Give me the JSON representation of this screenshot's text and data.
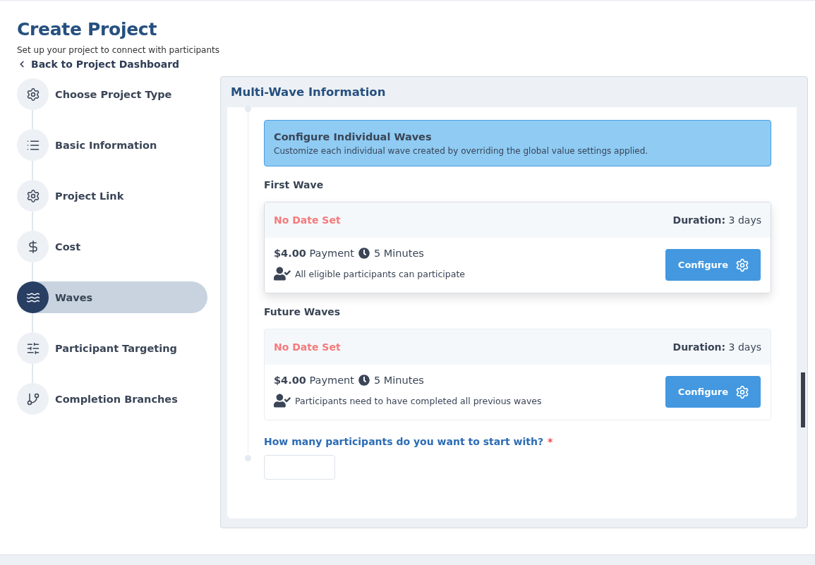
{
  "header": {
    "title": "Create Project",
    "subtitle": "Set up your project to connect with participants",
    "back_link": "Back to Project Dashboard"
  },
  "steps": [
    {
      "label": "Choose Project Type",
      "kind": "gear",
      "selected": false
    },
    {
      "label": "Basic Information",
      "kind": "list",
      "selected": false
    },
    {
      "label": "Project Link",
      "kind": "gear",
      "selected": false
    },
    {
      "label": "Cost",
      "kind": "dollar",
      "selected": false
    },
    {
      "label": "Waves",
      "kind": "waves",
      "selected": true
    },
    {
      "label": "Participant Targeting",
      "kind": "sliders",
      "selected": false
    },
    {
      "label": "Completion Branches",
      "kind": "branch",
      "selected": false
    }
  ],
  "panel": {
    "title": "Multi-Wave Information",
    "info_box": {
      "title": "Configure Individual Waves",
      "text": "Customize each individual wave created by overriding the global value settings applied."
    },
    "wave_groups": [
      {
        "heading": "First Wave",
        "raised": true,
        "date": "No Date Set",
        "duration": "**Duration:** 3 days",
        "payment": "**$4.00** Payment",
        "time": "5 Minutes",
        "eligibility": "All eligible participants can participate",
        "button": "Configure"
      },
      {
        "heading": "Future Waves",
        "raised": false,
        "date": "No Date Set",
        "duration": "**Duration:** 3 days",
        "payment": "**$4.00** Payment",
        "time": "5 Minutes",
        "eligibility": "Participants need to have completed all previous waves",
        "button": "Configure"
      }
    ],
    "question": {
      "label": "How many participants do you want to start with?",
      "required_mark": "*"
    }
  }
}
